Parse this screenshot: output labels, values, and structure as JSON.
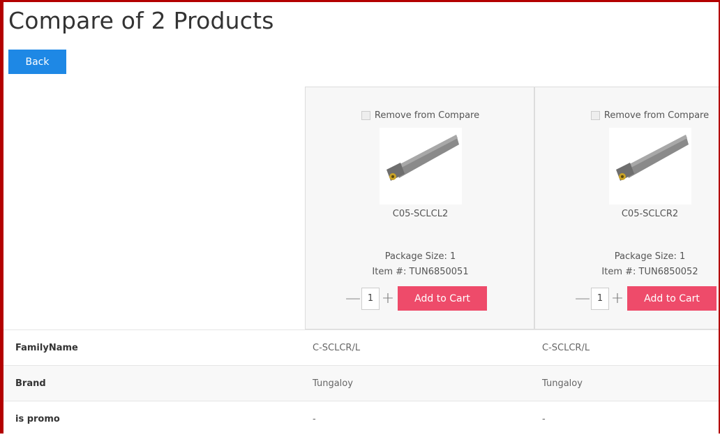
{
  "page": {
    "title": "Compare of 2 Products",
    "back_label": "Back"
  },
  "colors": {
    "back_button": "#1e88e5",
    "add_to_cart": "#ee4b6a",
    "frame": "#b30000"
  },
  "products": [
    {
      "remove_label": "Remove from Compare",
      "image_icon": "boring-bar-tool-image",
      "name": "C05-SCLCL2",
      "package_size": "Package Size: 1",
      "item_number": "Item #: TUN6850051",
      "quantity": "1",
      "add_to_cart_label": "Add to Cart"
    },
    {
      "remove_label": "Remove from Compare",
      "image_icon": "boring-bar-tool-image",
      "name": "C05-SCLCR2",
      "package_size": "Package Size: 1",
      "item_number": "Item #: TUN6850052",
      "quantity": "1",
      "add_to_cart_label": "Add to Cart"
    }
  ],
  "attributes": [
    {
      "label": "FamilyName",
      "values": [
        "C-SCLCR/L",
        "C-SCLCR/L"
      ]
    },
    {
      "label": "Brand",
      "values": [
        "Tungaloy",
        "Tungaloy"
      ]
    },
    {
      "label": "is promo",
      "values": [
        "-",
        "-"
      ]
    }
  ]
}
